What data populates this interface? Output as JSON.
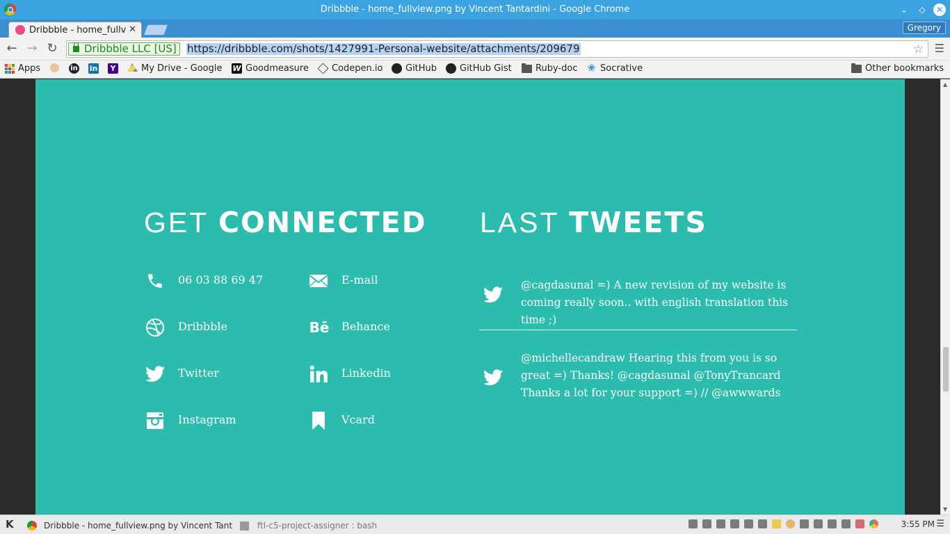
{
  "window": {
    "title": "Dribbble - home_fullview.png by Vincent Tantardini - Google Chrome"
  },
  "tabs": [
    {
      "label": "Dribbble - home_fullv",
      "active": true
    }
  ],
  "profile": {
    "name": "Gregory"
  },
  "toolbar": {
    "ev_label": "Dribbble LLC [US]",
    "url": "https://dribbble.com/shots/1427991-Personal-website/attachments/209679"
  },
  "bookmarks": {
    "apps": "Apps",
    "items": [
      "My Drive - Google",
      "Goodmeasure",
      "Codepen.io",
      "GitHub",
      "GitHub Gist",
      "Ruby-doc",
      "Socrative"
    ],
    "other": "Other bookmarks"
  },
  "page": {
    "connected": {
      "light": "GET ",
      "bold": "CONNECTED"
    },
    "tweets_heading": {
      "light": "LAST ",
      "bold": "TWEETS"
    },
    "contacts": [
      {
        "label": "06 03 88 69 47",
        "icon": "phone-icon"
      },
      {
        "label": "E-mail",
        "icon": "envelope-icon"
      },
      {
        "label": "Dribbble",
        "icon": "dribbble-icon"
      },
      {
        "label": "Behance",
        "icon": "behance-icon"
      },
      {
        "label": "Twitter",
        "icon": "twitter-icon"
      },
      {
        "label": "Linkedin",
        "icon": "linkedin-icon"
      },
      {
        "label": "Instagram",
        "icon": "instagram-icon"
      },
      {
        "label": "Vcard",
        "icon": "bookmark-icon"
      }
    ],
    "tweets": [
      {
        "text": "@cagdasunal =) A new revision of my website is coming really soon.. with english translation this time ;)"
      },
      {
        "text": "@michellecandraw Hearing this from you is so great =) Thanks! @cagdasunal @TonyTrancard Thanks a lot for your support =) // @awwwards"
      }
    ],
    "background_color": "#2bbcad"
  },
  "taskbar": {
    "tasks": [
      {
        "label": "Dribbble - home_fullview.png by Vincent Tant",
        "active": true
      },
      {
        "label": "ftl-c5-project-assigner : bash",
        "active": false
      }
    ],
    "clock": "3:55 PM"
  }
}
